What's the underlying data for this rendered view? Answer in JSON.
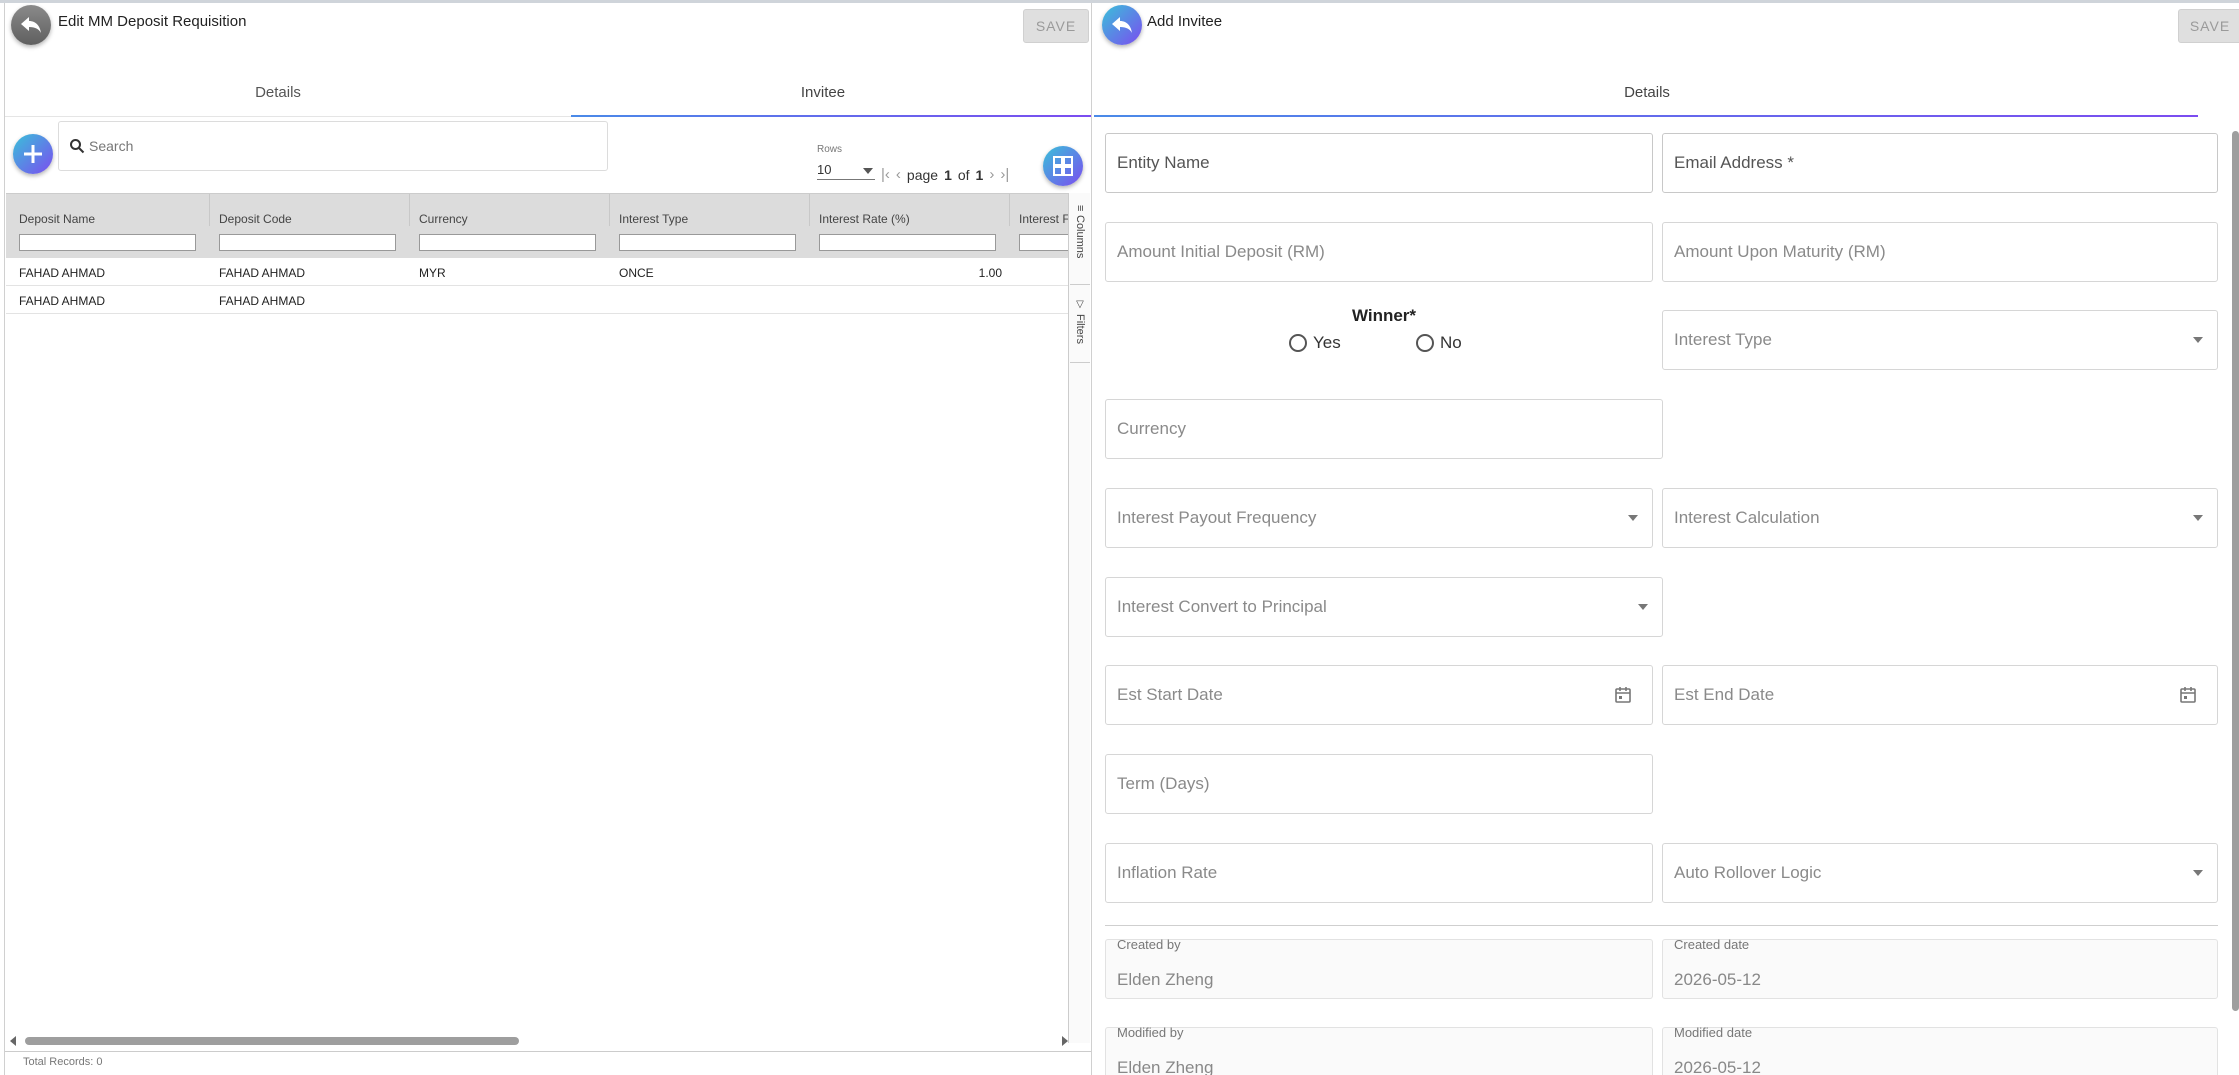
{
  "left": {
    "title": "Edit MM Deposit Requisition",
    "save_label": "SAVE",
    "tabs": [
      {
        "label": "Details"
      },
      {
        "label": "Invitee"
      }
    ],
    "search_placeholder": "Search",
    "rows_label": "Rows",
    "rows_value": "10",
    "pager": {
      "prefix": "page",
      "current": "1",
      "of": "of",
      "total": "1"
    },
    "columns": [
      "Deposit Name",
      "Deposit Code",
      "Currency",
      "Interest Type",
      "Interest Rate (%)",
      "Interest F"
    ],
    "rows": [
      [
        "FAHAD AHMAD",
        "FAHAD AHMAD",
        "MYR",
        "ONCE",
        "1.00"
      ],
      [
        "FAHAD AHMAD",
        "FAHAD AHMAD",
        "",
        "",
        ""
      ]
    ],
    "side_tabs": {
      "columns": "Columns",
      "filters": "Filters"
    },
    "total_records": "Total Records: 0"
  },
  "right": {
    "title": "Add Invitee",
    "save_label": "SAVE",
    "tab": "Details",
    "fields": {
      "entity_name": "Entity Name",
      "email": "Email Address *",
      "amount_initial": "Amount Initial Deposit (RM)",
      "amount_maturity": "Amount Upon Maturity (RM)",
      "interest_type": "Interest Type",
      "currency": "Currency",
      "payout_frequency": "Interest Payout Frequency",
      "interest_calculation": "Interest Calculation",
      "convert_principal": "Interest Convert to Principal",
      "start_date": "Est Start Date",
      "end_date": "Est End Date",
      "term": "Term (Days)",
      "inflation_rate": "Inflation Rate",
      "auto_rollover": "Auto Rollover Logic"
    },
    "winner": {
      "label": "Winner*",
      "yes": "Yes",
      "no": "No"
    },
    "audit": {
      "created_by_label": "Created by",
      "created_by": "Elden Zheng",
      "created_date_label": "Created date",
      "created_date": "2026-05-12",
      "modified_by_label": "Modified by",
      "modified_by": "Elden Zheng",
      "modified_date_label": "Modified date",
      "modified_date": "2026-05-12"
    }
  }
}
